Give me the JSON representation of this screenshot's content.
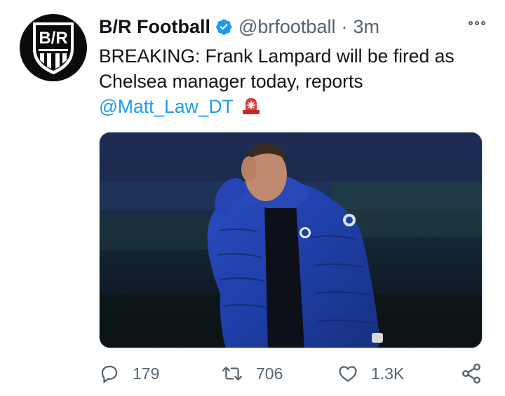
{
  "account": {
    "name": "B/R Football",
    "handle": "@brfootball",
    "separator": "·",
    "time": "3m",
    "avatar_text": "B/R"
  },
  "tweet": {
    "line1": "BREAKING: Frank Lampard will be fired as",
    "line2": "Chelsea manager today, reports",
    "mention": "@Matt_Law_DT",
    "emoji": "rotating-light-icon"
  },
  "media": {
    "description_icon": "photo"
  },
  "actions": {
    "replies": "179",
    "retweets": "706",
    "likes": "1.3K"
  },
  "colors": {
    "link": "#1d9bf0",
    "text": "#0f1419",
    "muted": "#536471",
    "verified": "#1d9bf0"
  }
}
